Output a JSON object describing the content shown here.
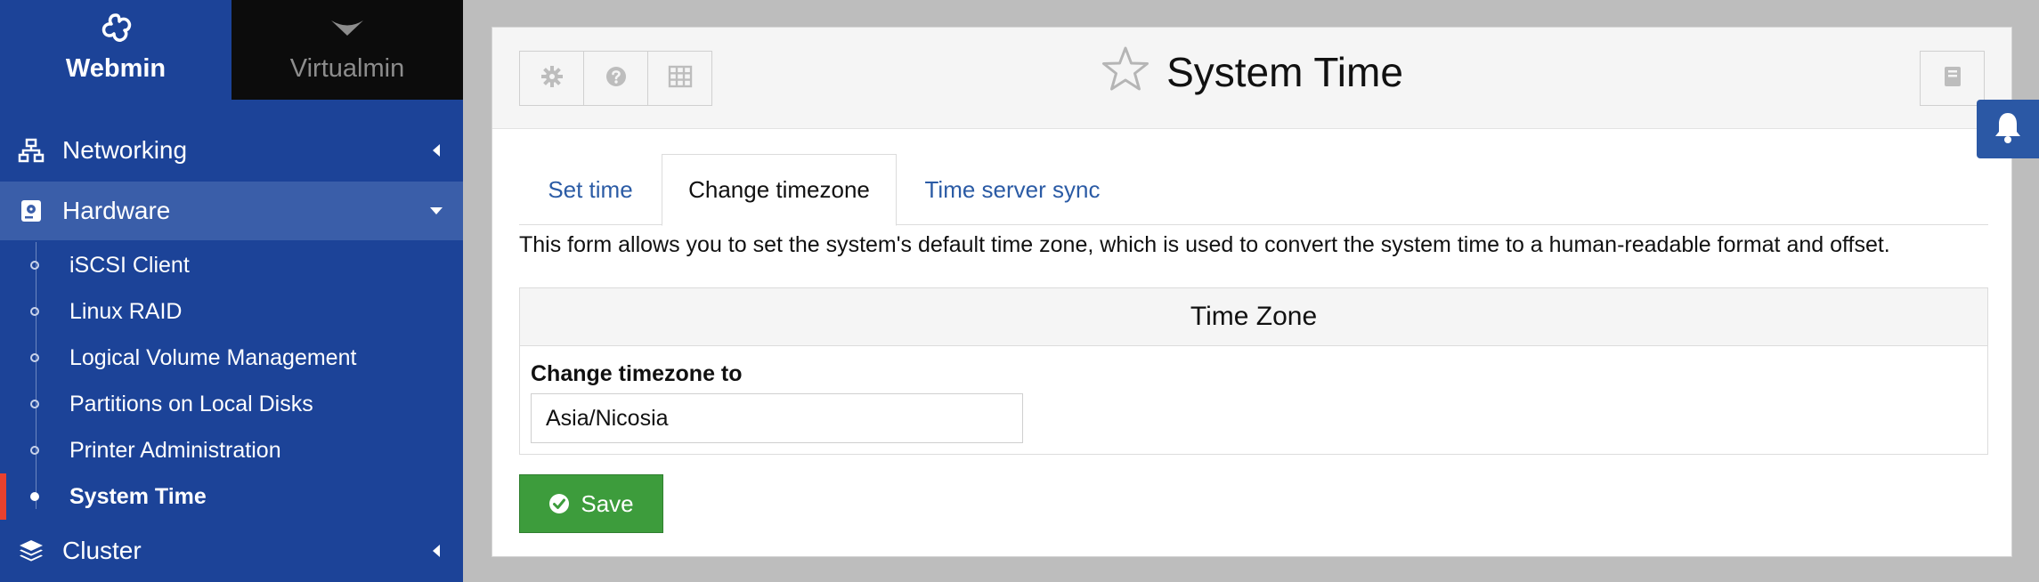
{
  "sidebar": {
    "tabs": {
      "webmin": "Webmin",
      "virtualmin": "Virtualmin"
    },
    "nav": {
      "networking": "Networking",
      "hardware": "Hardware",
      "cluster": "Cluster"
    },
    "hardware_items": [
      "iSCSI Client",
      "Linux RAID",
      "Logical Volume Management",
      "Partitions on Local Disks",
      "Printer Administration",
      "System Time"
    ]
  },
  "header": {
    "title": "System Time"
  },
  "tabs": [
    "Set time",
    "Change timezone",
    "Time server sync"
  ],
  "description": "This form allows you to set the system's default time zone, which is used to convert the system time to a human-readable format and offset.",
  "timezone": {
    "section_title": "Time Zone",
    "label": "Change timezone to",
    "value": "Asia/Nicosia"
  },
  "actions": {
    "save": "Save"
  },
  "colors": {
    "sidebar": "#1c4398",
    "active": "#3a5ea9",
    "accent": "#e8412e",
    "save": "#3d9c3c"
  },
  "icons": [
    "webmin-logo-icon",
    "virtualmin-chevron-icon",
    "networking-icon",
    "hardware-icon",
    "cluster-icon",
    "gear-icon",
    "help-icon",
    "grid-icon",
    "star-icon",
    "book-icon",
    "check-circle-icon",
    "bell-icon"
  ]
}
